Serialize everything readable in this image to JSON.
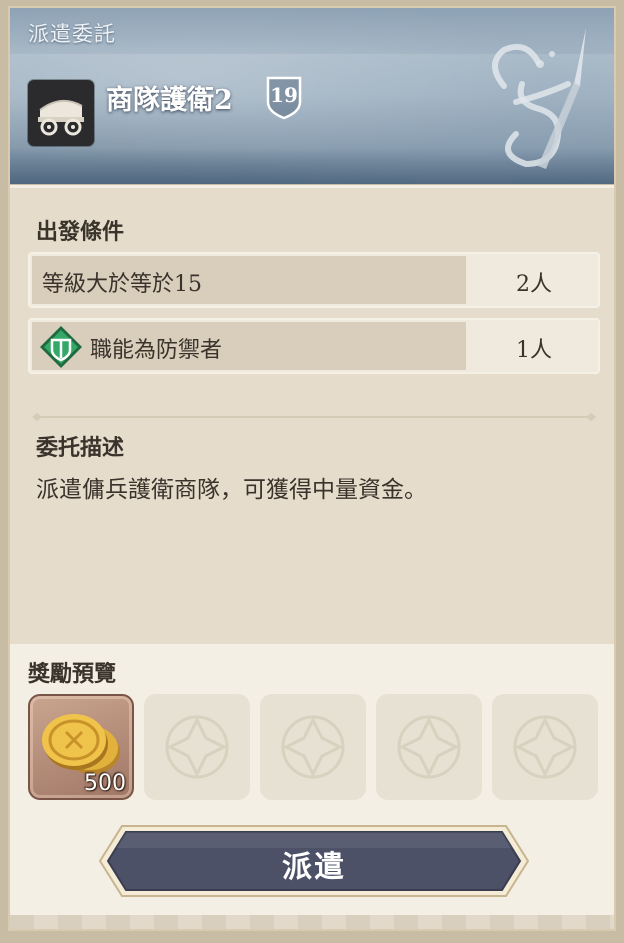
{
  "header": {
    "section_title": "派遣委託",
    "mission_name": "商隊護衛2",
    "level": "19",
    "mission_icon": "wagon-icon",
    "emblem_icon": "guild-emblem-icon"
  },
  "requirements": {
    "title": "出發條件",
    "items": [
      {
        "label": "等級大於等於15",
        "count": "2人",
        "icon": null
      },
      {
        "label": "職能為防禦者",
        "count": "1人",
        "icon": "defender-role-icon"
      }
    ]
  },
  "description": {
    "title": "委托描述",
    "text": "派遣傭兵護衛商隊，可獲得中量資金。"
  },
  "rewards": {
    "title": "獎勵預覽",
    "items": [
      {
        "icon": "gold-coins-icon",
        "count": "500"
      }
    ],
    "empty_slots": 4
  },
  "actions": {
    "dispatch_label": "派遣"
  },
  "colors": {
    "header_blue": "#a2b4c3",
    "panel_bg": "#e5dccb",
    "text_dark": "#3a332b",
    "button_navy": "#4d5168",
    "role_green": "#2e9a5f",
    "coin_gold": "#e2b13c"
  }
}
